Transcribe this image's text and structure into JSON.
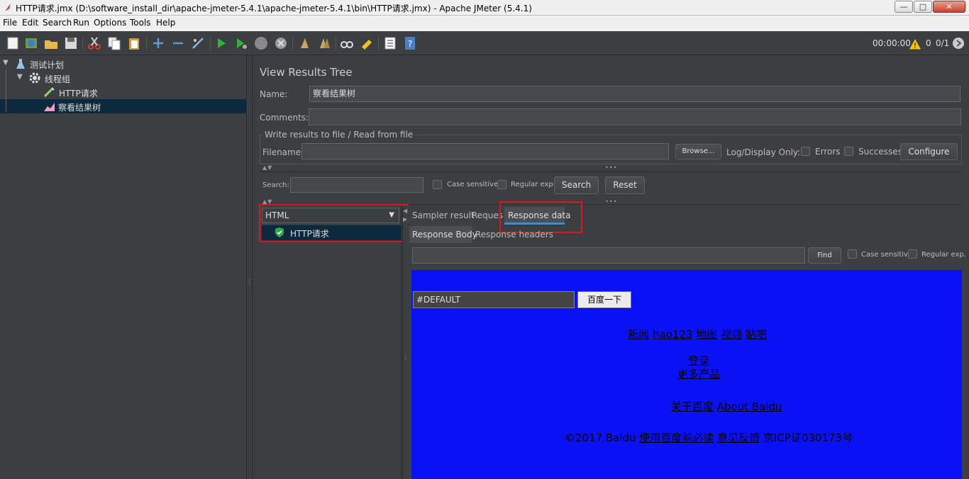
{
  "window": {
    "title": "HTTP请求.jmx (D:\\software_install_dir\\apache-jmeter-5.4.1\\apache-jmeter-5.4.1\\bin\\HTTP请求.jmx) - Apache JMeter (5.4.1)",
    "controls": {
      "minimize": "—",
      "maximize": "□",
      "close": "✕"
    }
  },
  "menu": [
    "File",
    "Edit",
    "Search",
    "Run",
    "Options",
    "Tools",
    "Help"
  ],
  "toolbar": {
    "timer": "00:00:00",
    "warning_count": "0",
    "threads": "0/1"
  },
  "tree": {
    "items": [
      {
        "label": "测试计划"
      },
      {
        "label": "线程组"
      },
      {
        "label": "HTTP请求"
      },
      {
        "label": "察看结果树"
      }
    ]
  },
  "panel": {
    "title": "View Results Tree",
    "name_label": "Name:",
    "name_value": "察看结果树",
    "comments_label": "Comments:",
    "comments_value": "",
    "file_section_title": "Write results to file / Read from file",
    "filename_label": "Filename",
    "filename_value": "",
    "browse_label": "Browse...",
    "log_display_label": "Log/Display Only:",
    "errors_label": "Errors",
    "successes_label": "Successes",
    "configure_label": "Configure"
  },
  "search": {
    "label": "Search:",
    "value": "",
    "case_sensitive_label": "Case sensitive",
    "regex_label": "Regular exp.",
    "search_button": "Search",
    "reset_button": "Reset"
  },
  "results": {
    "renderer": "HTML",
    "items": [
      {
        "label": "HTTP请求",
        "status": "success"
      }
    ],
    "tabs": [
      "Sampler result",
      "Reques",
      "Response data"
    ],
    "active_tab": "Response data",
    "subtabs": [
      "Response Body",
      "Response headers"
    ],
    "active_subtab": "Response Body",
    "find_value": "",
    "find_button": "Find",
    "find_case_label": "Case sensitive",
    "find_regex_label": "Regular exp."
  },
  "response_page": {
    "input_value": "#DEFAULT",
    "submit_label": "百度一下",
    "nav_links": [
      "新闻",
      "hao123",
      "地图",
      "视频",
      "贴吧"
    ],
    "login_link": "登录",
    "more_link": "更多产品",
    "about_links": [
      "关于百度",
      "About Baidu"
    ],
    "footer_prefix": "©2017 Baidu",
    "footer_links": [
      "使用百度前必读",
      "意见反馈"
    ],
    "footer_suffix": "京ICP证030173号",
    "background_color": "#0a12f5"
  },
  "colors": {
    "highlight": "#e0141e",
    "panel_bg": "#3c3f41",
    "selected_bg": "#0d293e",
    "active_tab_underline": "#4a88c7"
  }
}
